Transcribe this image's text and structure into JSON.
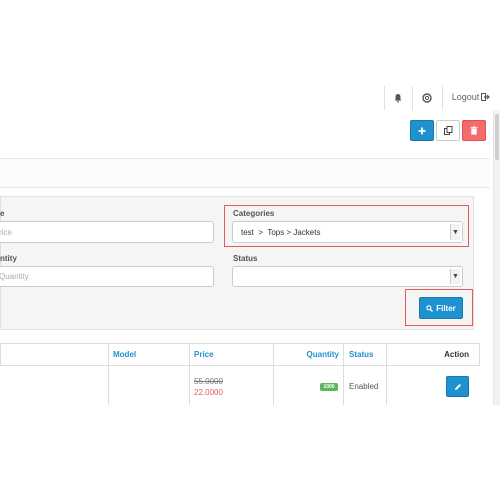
{
  "header": {
    "bell_icon": "bell-icon",
    "help_icon": "life-ring-icon",
    "logout_label": "Logout",
    "logout_icon": "sign-out-icon"
  },
  "toolbar": {
    "add_icon": "plus-icon",
    "copy_icon": "copy-icon",
    "delete_icon": "trash-icon"
  },
  "filter": {
    "name_label": "e",
    "name_placeholder": "rice",
    "categories_label": "Categories",
    "categories_value": "test  >  Tops > Jackets",
    "quantity_label": "ntity",
    "quantity_placeholder": "Quantity",
    "status_label": "Status",
    "status_value": "",
    "filter_button_label": "Filter",
    "filter_icon": "search-icon"
  },
  "table": {
    "columns": {
      "model": "Model",
      "price": "Price",
      "quantity": "Quantity",
      "status": "Status",
      "action": "Action"
    },
    "rows": [
      {
        "model": "",
        "price_old": "55.0000",
        "price_special": "22.0000",
        "quantity": "1000",
        "status": "Enabled",
        "edit_icon": "pencil-icon"
      }
    ]
  },
  "colors": {
    "primary": "#1e91cf",
    "danger": "#f56b6b",
    "success": "#5cb85c",
    "highlight": "#e85a5a"
  }
}
